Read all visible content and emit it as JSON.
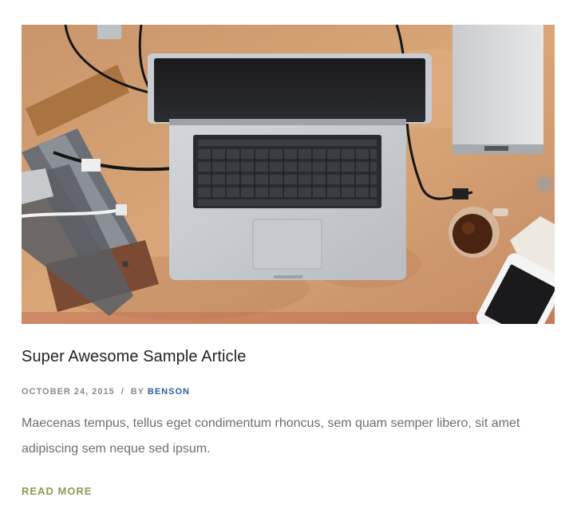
{
  "post": {
    "image_alt": "Laptop on a wooden desk with cables, tools, a glass of tea and a phone",
    "title": "Super Awesome Sample Article",
    "date": "OCTOBER 24, 2015",
    "separator": "/",
    "by_label": "BY",
    "author": "BENSON",
    "excerpt": "Maecenas tempus, tellus eget condimentum rhoncus, sem quam semper libero, sit amet adipiscing sem neque sed ipsum.",
    "read_more": "READ MORE"
  },
  "colors": {
    "author_link": "#2d5f9e",
    "read_more": "#8a9a55",
    "meta_text": "#8a8a8a",
    "excerpt_text": "#6e6e6e",
    "title_text": "#222222"
  }
}
